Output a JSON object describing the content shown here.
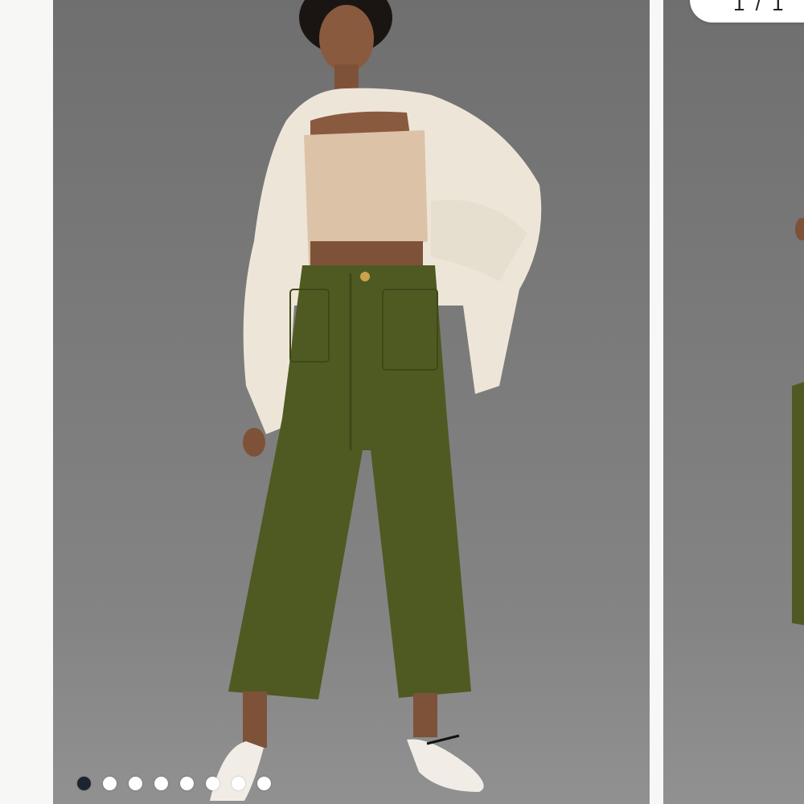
{
  "carousel": {
    "slide_count": 8,
    "active_index": 0,
    "images": [
      {
        "alt": "",
        "icon": "model-photo"
      },
      {
        "alt": "",
        "icon": "model-photo"
      }
    ]
  },
  "badge": {
    "text": "1 / 1"
  },
  "colors": {
    "backdrop": "#777777",
    "pants": "#4e5a22",
    "cardigan": "#efe9dc",
    "top": "#dcc3a8",
    "active_dot": "#1e2330",
    "inactive_dot": "#ffffff"
  }
}
